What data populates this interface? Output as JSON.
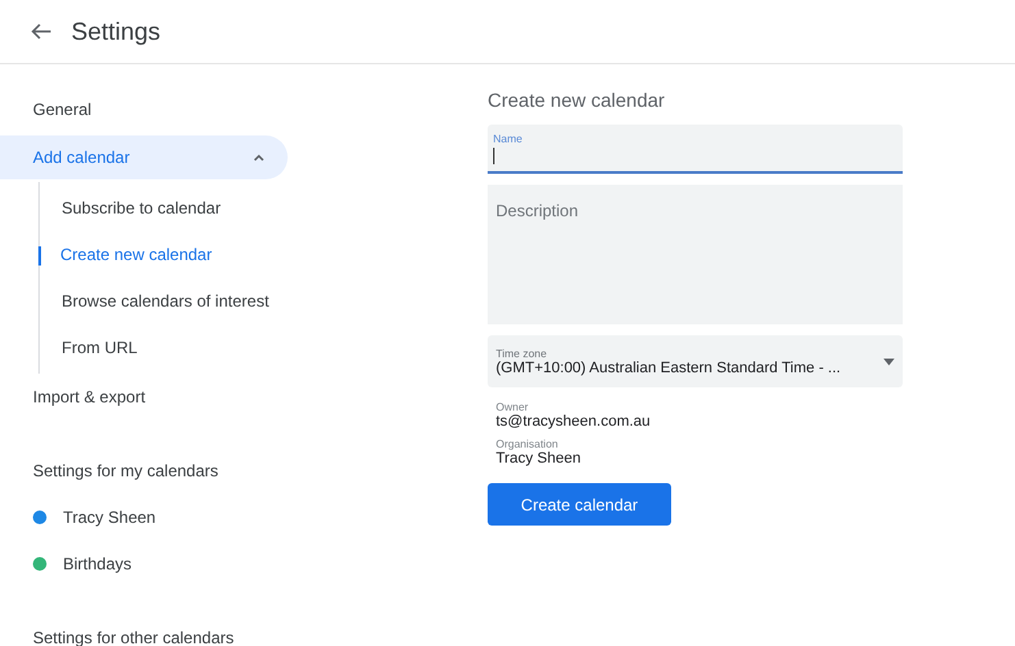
{
  "header": {
    "title": "Settings"
  },
  "sidebar": {
    "items": [
      {
        "kind": "link",
        "label": "General"
      },
      {
        "kind": "group",
        "label": "Add calendar",
        "expanded": true,
        "children": [
          {
            "label": "Subscribe to calendar",
            "selected": false
          },
          {
            "label": "Create new calendar",
            "selected": true
          },
          {
            "label": "Browse calendars of interest",
            "selected": false
          },
          {
            "label": "From URL",
            "selected": false
          }
        ]
      },
      {
        "kind": "link",
        "label": "Import & export"
      },
      {
        "kind": "heading",
        "label": "Settings for my calendars"
      },
      {
        "kind": "calendar",
        "label": "Tracy Sheen",
        "color": "#1e88e5"
      },
      {
        "kind": "calendar",
        "label": "Birthdays",
        "color": "#33b679"
      },
      {
        "kind": "heading",
        "label": "Settings for other calendars"
      }
    ]
  },
  "form": {
    "title": "Create new calendar",
    "name_field": {
      "label": "Name",
      "focused": true
    },
    "description_field": {
      "placeholder": "Description"
    },
    "time_zone": {
      "label": "Time zone",
      "value": "(GMT+10:00) Australian Eastern Standard Time - ..."
    },
    "info": [
      {
        "label": "Owner",
        "value": "ts@tracysheen.com.au"
      },
      {
        "label": "Organisation",
        "value": "Tracy Sheen"
      }
    ],
    "button": "Create calendar"
  }
}
